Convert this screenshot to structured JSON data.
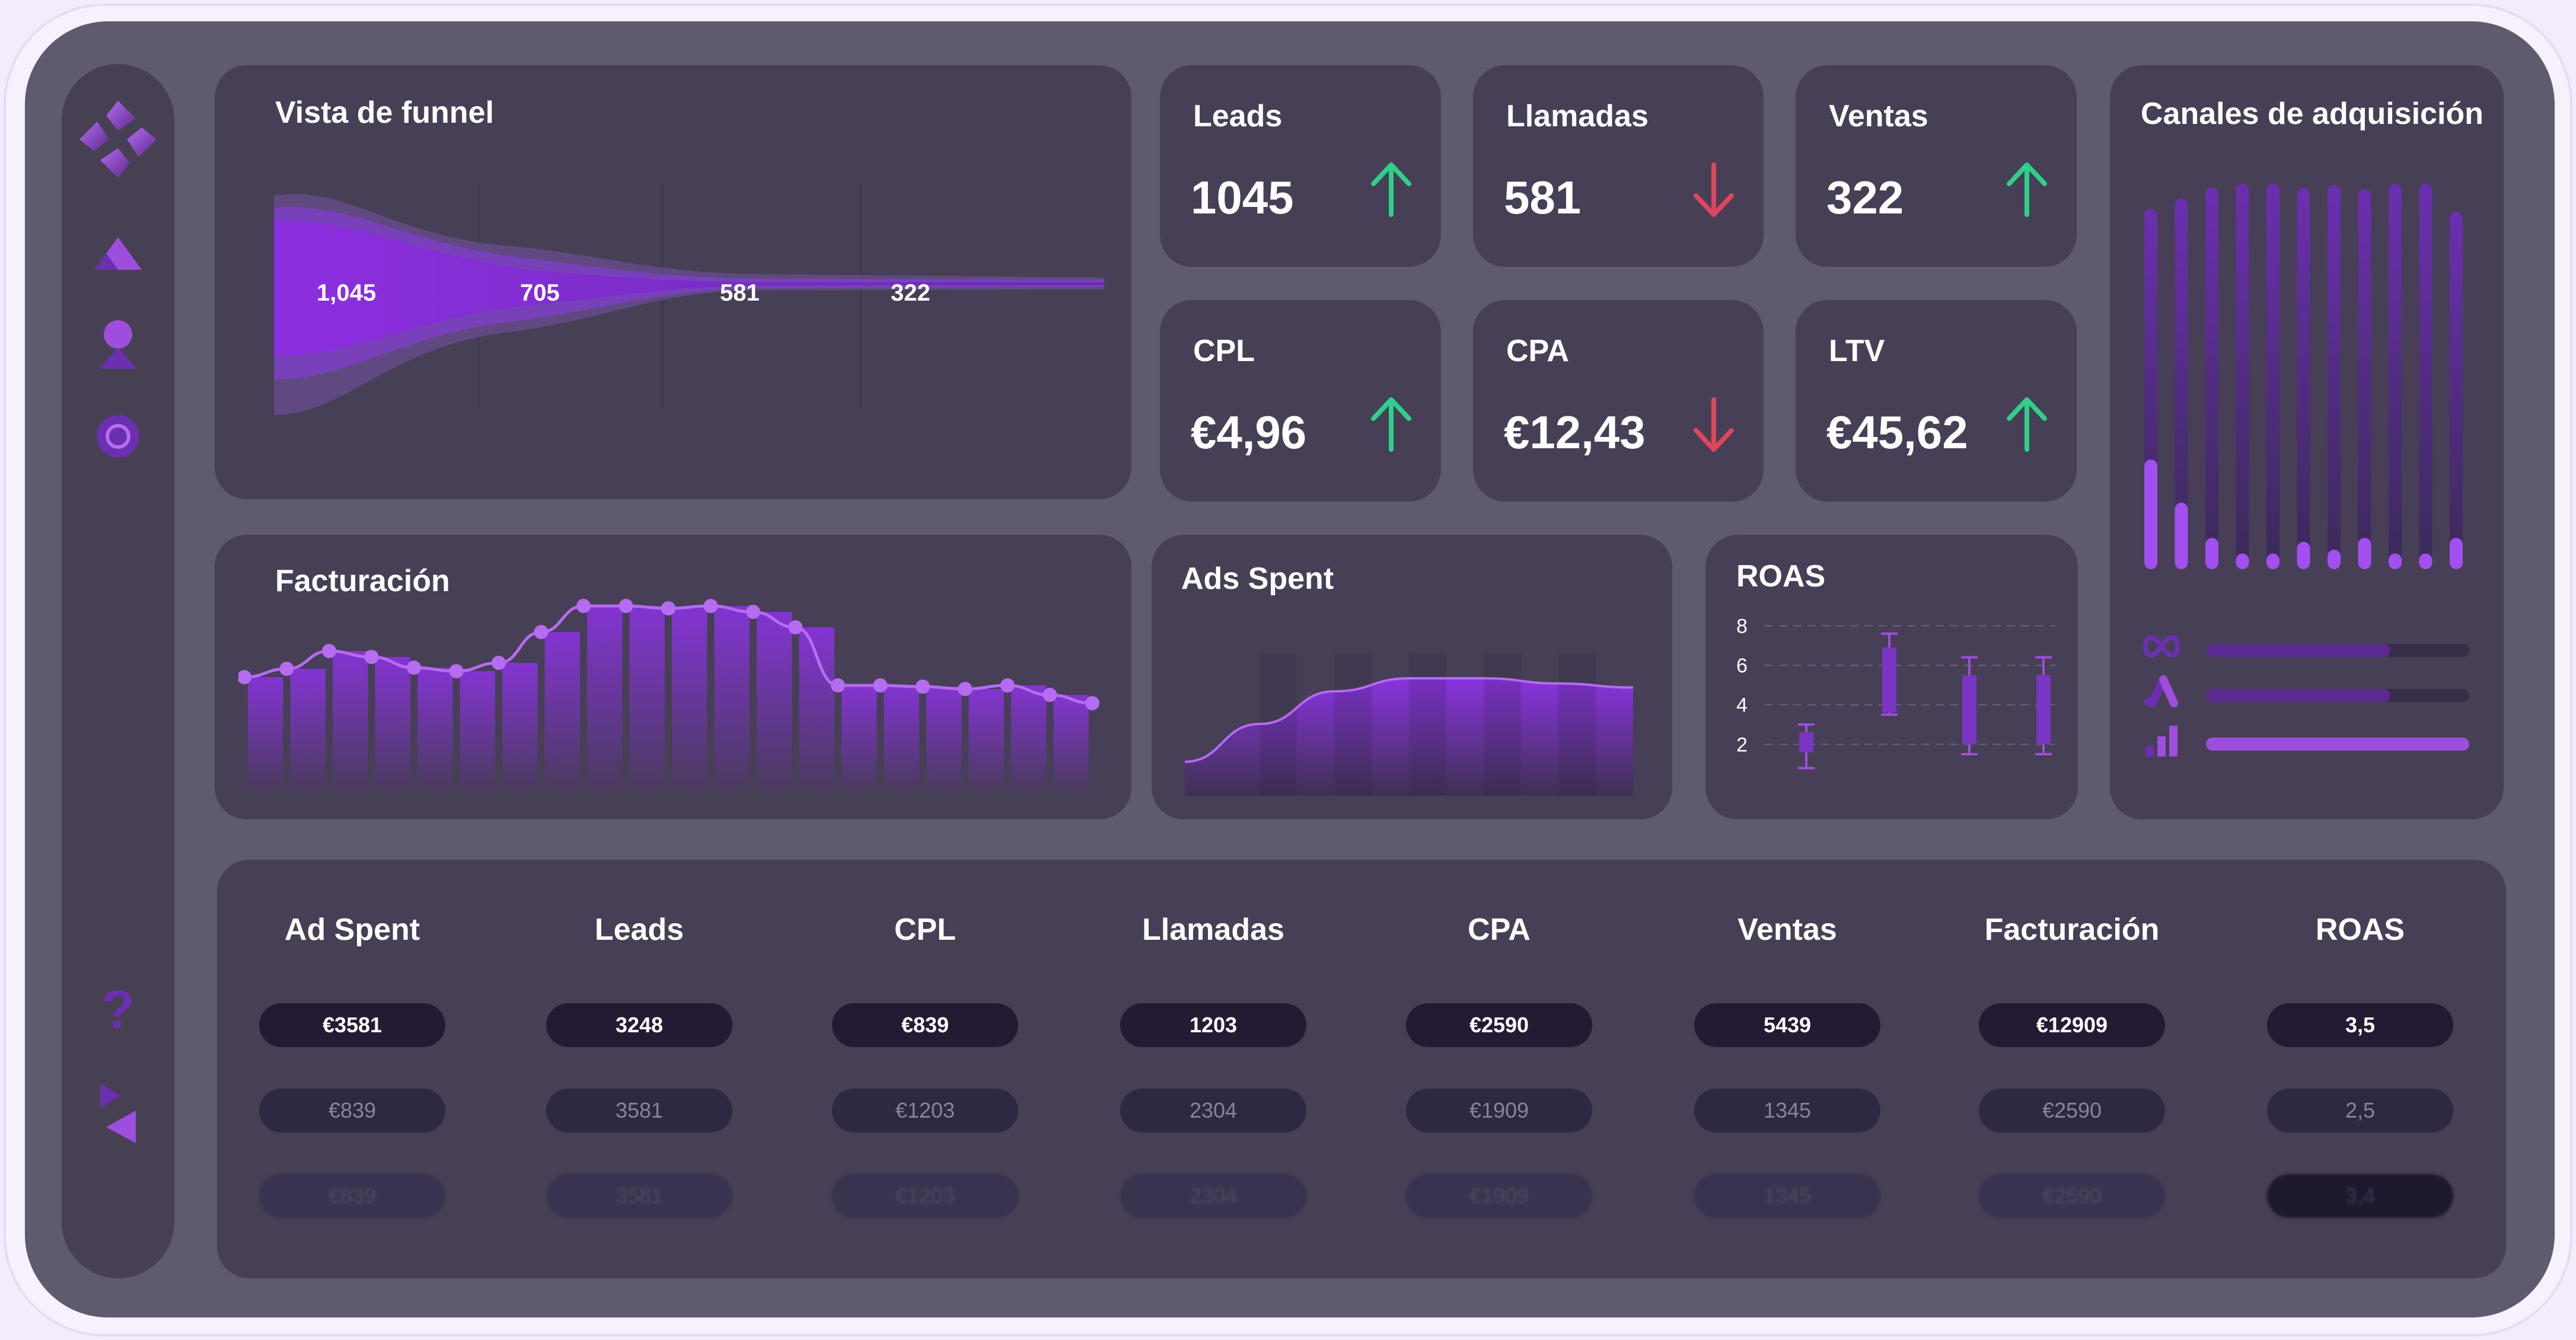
{
  "colors": {
    "accent": "#9d4edd",
    "accent_dark": "#5b2a8e",
    "up": "#2fd08a",
    "down": "#e0455e",
    "card": "#463f55",
    "background": "#5f5a6e"
  },
  "sidebar": {
    "items": [
      {
        "icon": "logo-icon"
      },
      {
        "icon": "triangle-icon"
      },
      {
        "icon": "user-icon"
      },
      {
        "icon": "circle-target-icon"
      }
    ],
    "bottom": [
      {
        "icon": "help-icon",
        "label": "?"
      },
      {
        "icon": "collapse-icon"
      }
    ]
  },
  "funnel": {
    "title": "Vista de funnel",
    "stages": [
      "1,045",
      "705",
      "581",
      "322"
    ]
  },
  "kpis": [
    {
      "label": "Leads",
      "value": "1045",
      "trend": "up"
    },
    {
      "label": "Llamadas",
      "value": "581",
      "trend": "down"
    },
    {
      "label": "Ventas",
      "value": "322",
      "trend": "up"
    },
    {
      "label": "CPL",
      "value": "€4,96",
      "trend": "up"
    },
    {
      "label": "CPA",
      "value": "€12,43",
      "trend": "down"
    },
    {
      "label": "LTV",
      "value": "€45,62",
      "trend": "up"
    }
  ],
  "canales": {
    "title": "Canales de adquisición",
    "bars": [
      0.28,
      0.17,
      0.08,
      0.04,
      0.04,
      0.07,
      0.05,
      0.08,
      0.04,
      0.04,
      0.08
    ],
    "bar_tops": [
      0.52,
      0.7,
      0.89,
      0.95,
      0.95,
      0.88,
      0.93,
      0.86,
      0.95,
      0.95,
      0.47
    ],
    "channels": [
      {
        "icon": "meta-icon",
        "level": 0.7
      },
      {
        "icon": "google-ads-icon",
        "level": 0.7
      },
      {
        "icon": "analytics-icon",
        "level": 1.0
      }
    ]
  },
  "facturacion": {
    "title": "Facturación",
    "chart_data": {
      "type": "line",
      "values": [
        0.4,
        0.47,
        0.62,
        0.57,
        0.48,
        0.45,
        0.52,
        0.78,
        1.0,
        1.0,
        0.98,
        1.0,
        0.95,
        0.82,
        0.33,
        0.33,
        0.32,
        0.3,
        0.33,
        0.25,
        0.18
      ]
    }
  },
  "ads_spent": {
    "title": "Ads Spent",
    "chart_data": {
      "type": "area",
      "values": [
        0.26,
        0.55,
        0.8,
        0.9,
        0.9,
        0.86,
        0.83
      ]
    }
  },
  "roas": {
    "title": "ROAS",
    "chart_data": {
      "type": "box",
      "y_ticks": [
        "8",
        "6",
        "4",
        "2"
      ],
      "ylim": [
        0,
        9
      ],
      "boxes": [
        {
          "low": 0.8,
          "high": 3.0,
          "q1": 1.6,
          "q3": 2.6
        },
        {
          "low": 3.5,
          "high": 7.6,
          "q1": 3.6,
          "q3": 6.9
        },
        {
          "low": 1.5,
          "high": 6.4,
          "q1": 2.0,
          "q3": 5.5
        },
        {
          "low": 1.5,
          "high": 6.4,
          "q1": 2.0,
          "q3": 5.5
        }
      ]
    }
  },
  "table": {
    "headers": [
      "Ad Spent",
      "Leads",
      "CPL",
      "Llamadas",
      "CPA",
      "Ventas",
      "Facturación",
      "ROAS"
    ],
    "rows": [
      [
        "€3581",
        "3248",
        "€839",
        "1203",
        "€2590",
        "5439",
        "€12909",
        "3,5"
      ],
      [
        "€839",
        "3581",
        "€1203",
        "2304",
        "€1909",
        "1345",
        "€2590",
        "2,5"
      ],
      [
        "€839",
        "3581",
        "€1203",
        "2304",
        "€1909",
        "1345",
        "€2590",
        "3,4"
      ]
    ]
  }
}
